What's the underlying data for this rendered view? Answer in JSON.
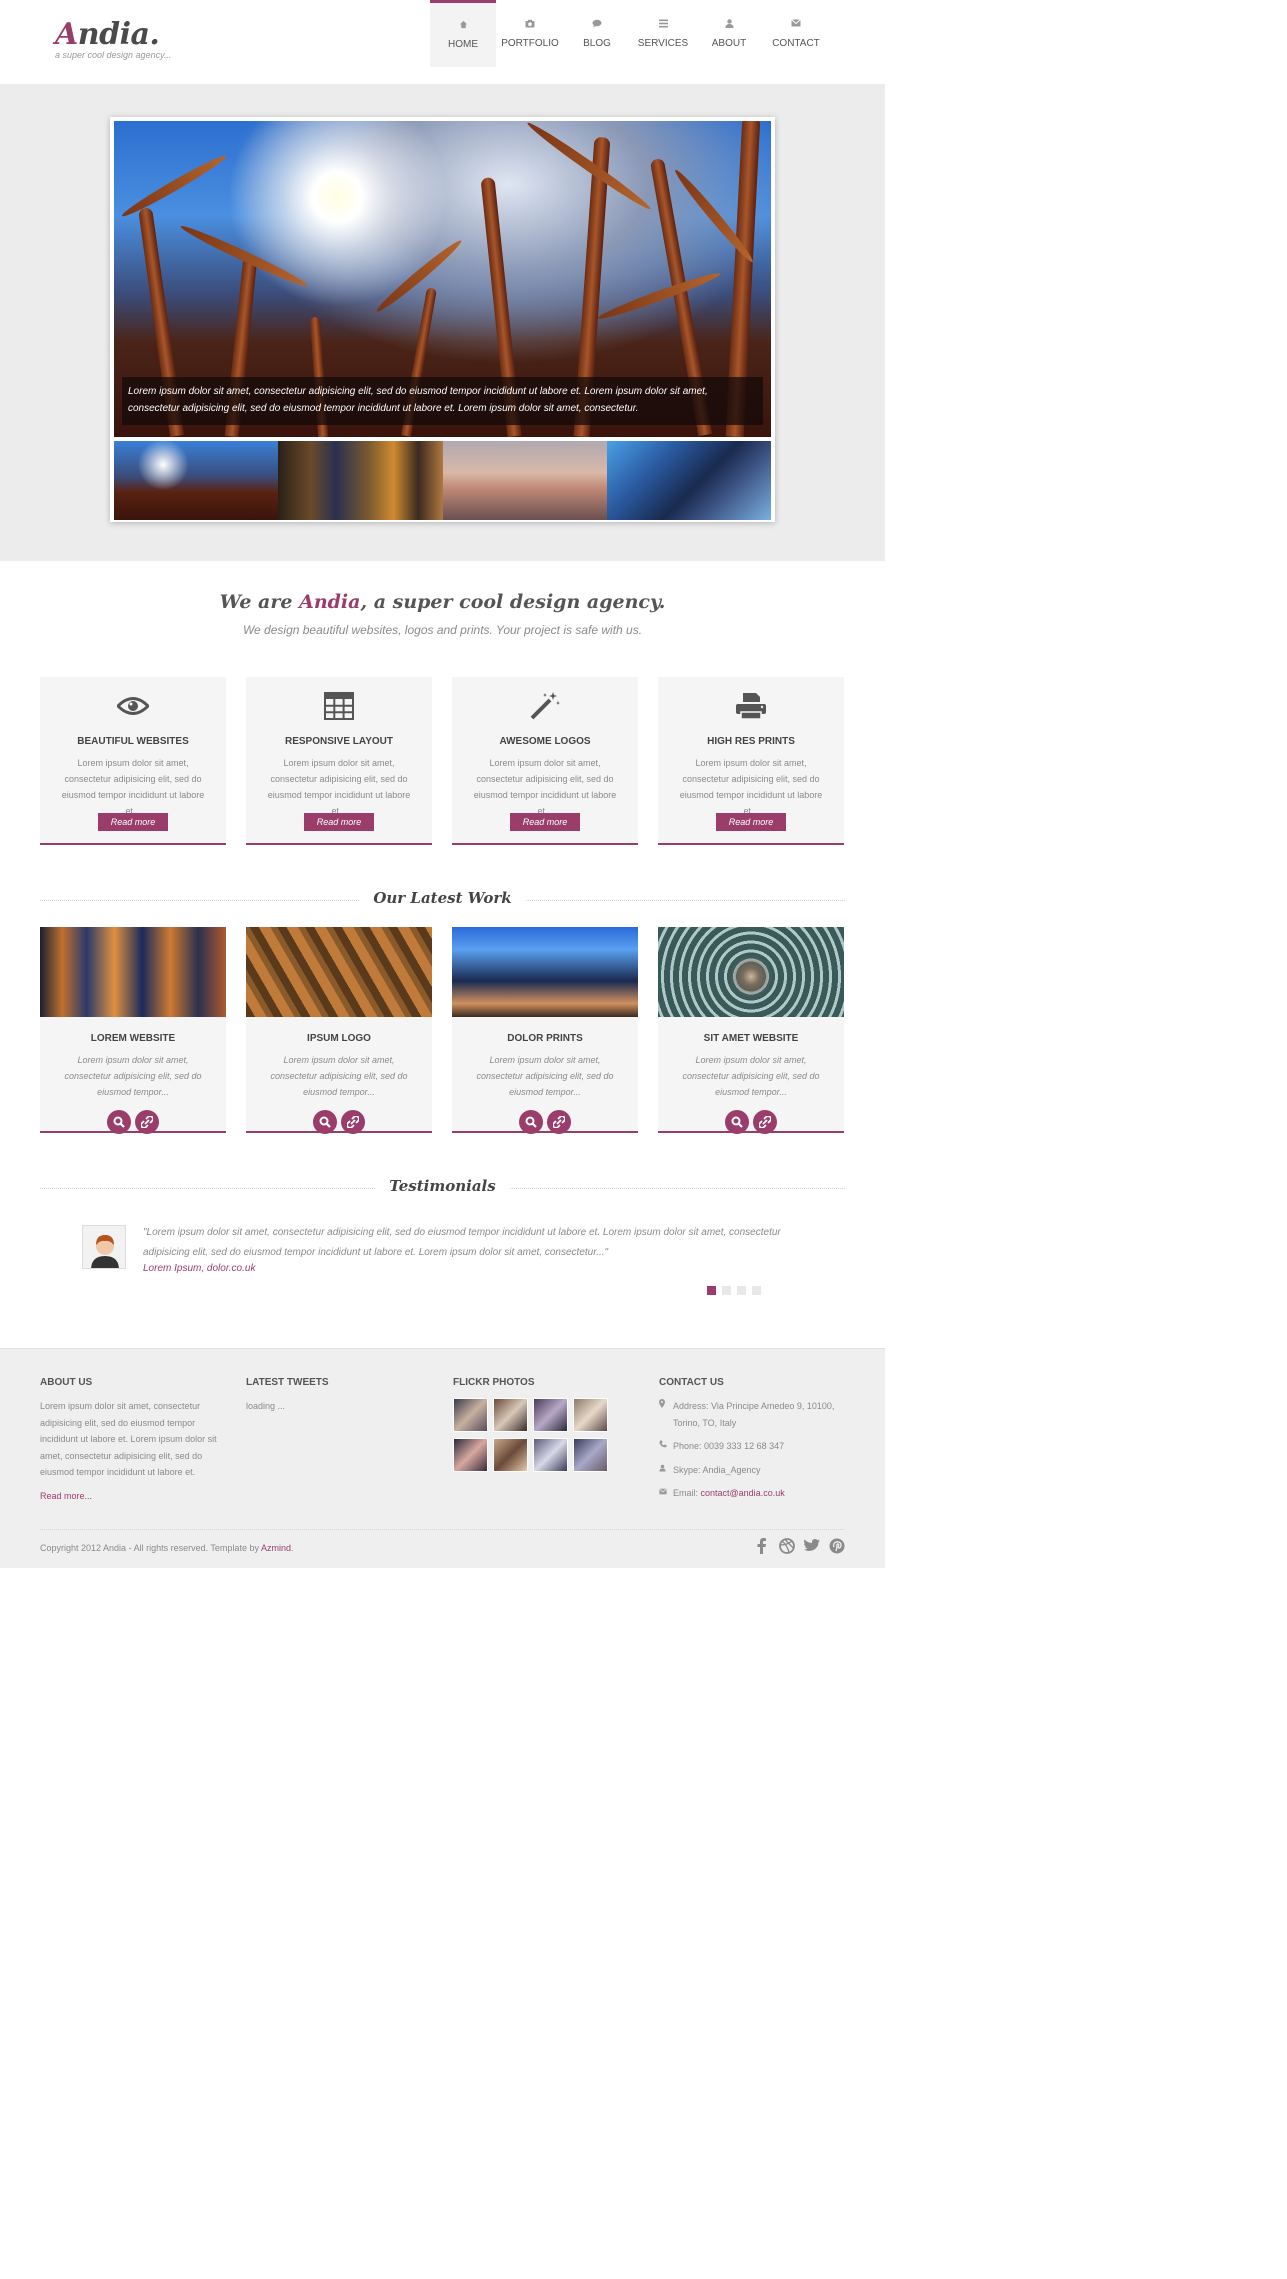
{
  "header": {
    "logo_first": "A",
    "logo_rest": "ndia.",
    "tagline": "a super cool design agency...",
    "nav": [
      {
        "label": "HOME",
        "icon": "home-icon"
      },
      {
        "label": "PORTFOLIO",
        "icon": "camera-icon"
      },
      {
        "label": "BLOG",
        "icon": "chat-icon"
      },
      {
        "label": "SERVICES",
        "icon": "list-icon"
      },
      {
        "label": "ABOUT",
        "icon": "user-icon"
      },
      {
        "label": "CONTACT",
        "icon": "mail-icon"
      }
    ],
    "active_index": 0
  },
  "slider": {
    "caption": "Lorem ipsum dolor sit amet, consectetur adipisicing elit, sed do eiusmod tempor incididunt ut labore et. Lorem ipsum dolor sit amet, consectetur adipisicing elit, sed do eiusmod tempor incididunt ut labore et. Lorem ipsum dolor sit amet, consectetur."
  },
  "intro": {
    "title_pre": "We are ",
    "title_brand": "Andia",
    "title_post": ", a super cool design agency.",
    "subtitle": "We design beautiful websites, logos and prints. Your project is safe with us."
  },
  "features": [
    {
      "title": "BEAUTIFUL WEBSITES",
      "icon": "eye-icon",
      "text": "Lorem ipsum dolor sit amet, consectetur adipisicing elit, sed do eiusmod tempor incididunt ut labore et...",
      "button": "Read more"
    },
    {
      "title": "RESPONSIVE LAYOUT",
      "icon": "grid-icon",
      "text": "Lorem ipsum dolor sit amet, consectetur adipisicing elit, sed do eiusmod tempor incididunt ut labore et...",
      "button": "Read more"
    },
    {
      "title": "AWESOME LOGOS",
      "icon": "magic-wand-icon",
      "text": "Lorem ipsum dolor sit amet, consectetur adipisicing elit, sed do eiusmod tempor incididunt ut labore et...",
      "button": "Read more"
    },
    {
      "title": "HIGH RES PRINTS",
      "icon": "printer-icon",
      "text": "Lorem ipsum dolor sit amet, consectetur adipisicing elit, sed do eiusmod tempor incididunt ut labore et...",
      "button": "Read more"
    }
  ],
  "latest_work": {
    "heading": "Our Latest Work",
    "items": [
      {
        "title": "LOREM WEBSITE",
        "text": "Lorem ipsum dolor sit amet, consectetur adipisicing elit, sed do eiusmod tempor..."
      },
      {
        "title": "IPSUM LOGO",
        "text": "Lorem ipsum dolor sit amet, consectetur adipisicing elit, sed do eiusmod tempor..."
      },
      {
        "title": "DOLOR PRINTS",
        "text": "Lorem ipsum dolor sit amet, consectetur adipisicing elit, sed do eiusmod tempor..."
      },
      {
        "title": "SIT AMET WEBSITE",
        "text": "Lorem ipsum dolor sit amet, consectetur adipisicing elit, sed do eiusmod tempor..."
      }
    ]
  },
  "testimonials": {
    "heading": "Testimonials",
    "quote": "\"Lorem ipsum dolor sit amet, consectetur adipisicing elit, sed do eiusmod tempor incididunt ut labore et. Lorem ipsum dolor sit amet, consectetur adipisicing elit, sed do eiusmod tempor incididunt ut labore et. Lorem ipsum dolor sit amet, consectetur...\"",
    "author": "Lorem Ipsum, dolor.co.uk",
    "pager_count": 4,
    "pager_active": 0
  },
  "footer": {
    "about": {
      "heading": "ABOUT US",
      "text": "Lorem ipsum dolor sit amet, consectetur adipisicing elit, sed do eiusmod tempor incididunt ut labore et. Lorem ipsum dolor sit amet, consectetur adipisicing elit, sed do eiusmod tempor incididunt ut labore et.",
      "more": "Read more..."
    },
    "tweets": {
      "heading": "LATEST TWEETS",
      "text": "loading ..."
    },
    "flickr": {
      "heading": "FLICKR PHOTOS"
    },
    "contact": {
      "heading": "CONTACT US",
      "address": "Address: Via Principe Amedeo 9, 10100, Torino, TO, Italy",
      "phone": "Phone: 0039 333 12 68 347",
      "skype": "Skype: Andia_Agency",
      "email_label": "Email: ",
      "email": "contact@andia.co.uk"
    },
    "copyright": "Copyright 2012 Andia - All rights reserved. Template by ",
    "copyright_link": "Azmind",
    "social": [
      "facebook-icon",
      "dribbble-icon",
      "twitter-icon",
      "pinterest-icon"
    ]
  },
  "colors": {
    "accent": "#9a3d6b",
    "text": "#6a6a6a",
    "band": "#ececec"
  }
}
